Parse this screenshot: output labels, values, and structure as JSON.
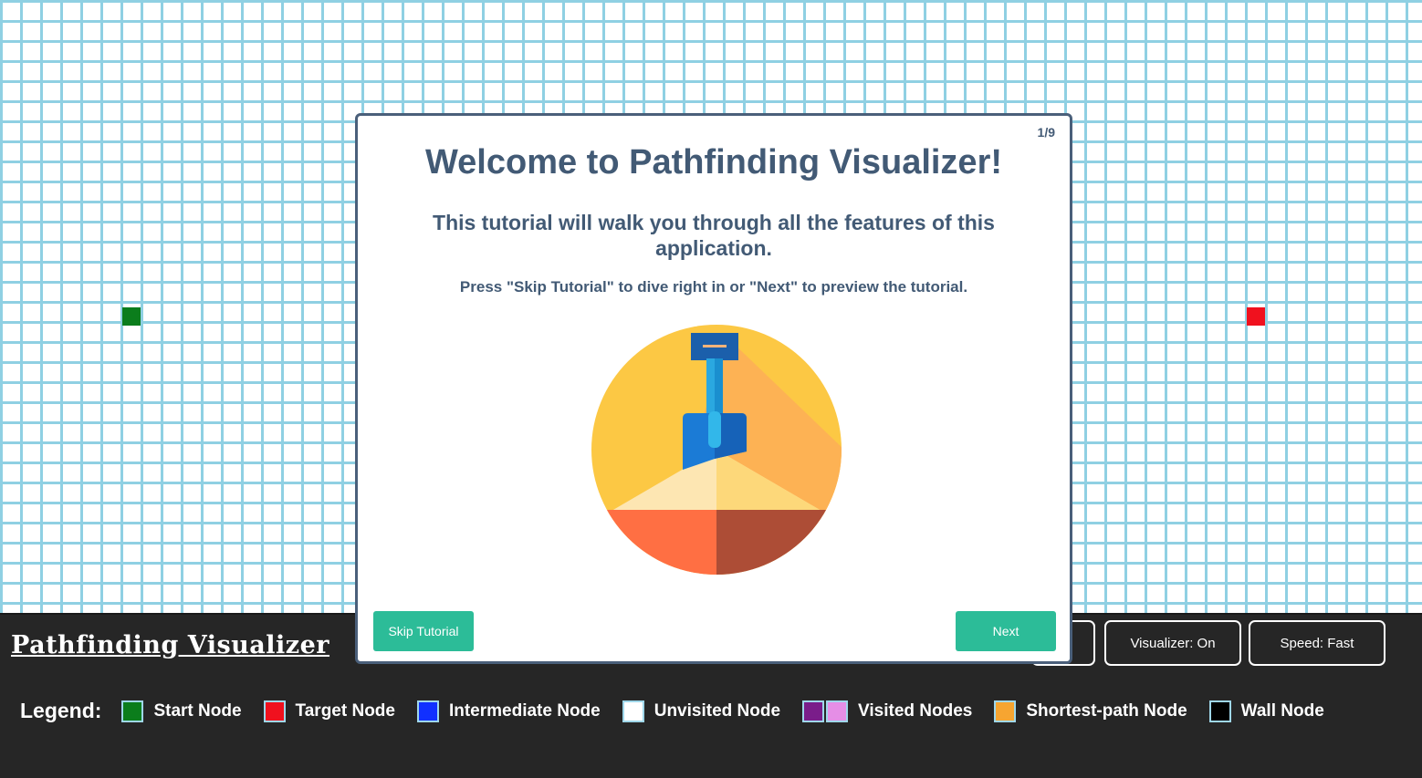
{
  "app": {
    "title": "Pathfinding Visualizer"
  },
  "toolbar": {
    "visualizer_label": "Visualizer: On",
    "speed_label": "Speed: Fast"
  },
  "legend": {
    "title": "Legend:",
    "items": [
      {
        "label": "Start Node",
        "color": "#0b7d1c"
      },
      {
        "label": "Target Node",
        "color": "#f0111e"
      },
      {
        "label": "Intermediate Node",
        "color": "#1130ff"
      },
      {
        "label": "Unvisited Node",
        "color": "#ffffff"
      },
      {
        "label": "Visited Nodes",
        "colors": [
          "#7a1d8a",
          "#e58ee6"
        ]
      },
      {
        "label": "Shortest-path Node",
        "color": "#f6a531"
      },
      {
        "label": "Wall Node",
        "color": "#000000"
      }
    ]
  },
  "tutorial": {
    "page_indicator": "1/9",
    "heading": "Welcome to Pathfinding Visualizer!",
    "subheading": "This tutorial will walk you through all the features of this application.",
    "note": "Press \"Skip Tutorial\" to dive right in or \"Next\" to preview the tutorial.",
    "skip_label": "Skip Tutorial",
    "next_label": "Next",
    "illustration": "shovel-in-sand-icon"
  },
  "colors": {
    "grid_line": "#8fd0e3",
    "start": "#0b7d1c",
    "target": "#f0111e",
    "modal_text": "#425a75",
    "button": "#2cbc98",
    "bar": "#262626"
  }
}
